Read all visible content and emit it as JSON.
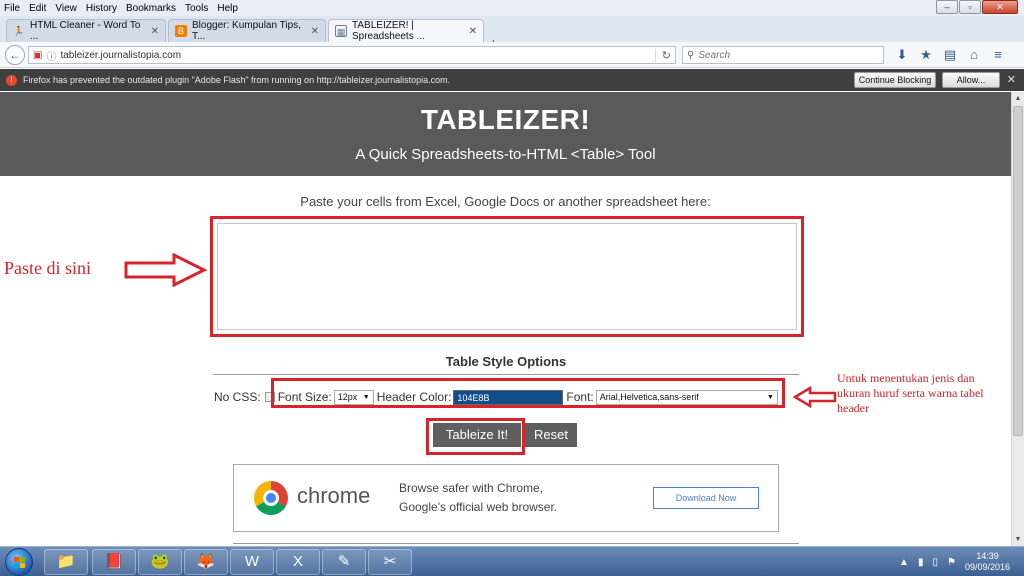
{
  "window": {
    "menu": [
      "File",
      "Edit",
      "View",
      "History",
      "Bookmarks",
      "Tools",
      "Help"
    ],
    "controls": {
      "minimize": "–",
      "restore": "▫",
      "close": "✕"
    }
  },
  "tabs": [
    {
      "label": "HTML Cleaner - Word To ...",
      "close": "✕"
    },
    {
      "label": "Blogger: Kumpulan Tips, T...",
      "close": "✕"
    },
    {
      "label": "TABLEIZER! | Spreadsheets ...",
      "close": "✕"
    }
  ],
  "new_tab": "+",
  "nav": {
    "url": "tableizer.journalistopia.com",
    "search_placeholder": "Search"
  },
  "notification": {
    "text": "Firefox has prevented the outdated plugin \"Adobe Flash\" from running on http://tableizer.journalistopia.com.",
    "continue_blocking": "Continue Blocking",
    "allow": "Allow...",
    "close": "✕"
  },
  "page": {
    "title": "TABLEIZER!",
    "subtitle": "A Quick Spreadsheets-to-HTML <Table> Tool",
    "prompt": "Paste your cells from Excel, Google Docs or another spreadsheet here:",
    "options_title": "Table Style Options",
    "no_css_label": "No CSS:",
    "font_size_label": "Font Size:",
    "font_size_value": "12px",
    "header_color_label": "Header Color:",
    "header_color_value": "104E8B",
    "font_label": "Font:",
    "font_value": "Arial,Helvetica,sans-serif",
    "tableize_button": "Tableize It!",
    "reset_button": "Reset"
  },
  "annotations": {
    "left": "Paste di sini",
    "right": "Untuk menentukan jenis dan ukuran huruf serta warna tabel header",
    "color": "#d8232a"
  },
  "ad": {
    "brand": "chrome",
    "line1": "Browse safer with Chrome,",
    "line2": "Google's official web browser.",
    "download": "Download Now"
  },
  "taskbar": {
    "time": "14:39",
    "date": "09/09/2016"
  },
  "colors": {
    "hero_bg": "#5a5a5a",
    "header_color": "#104e8b",
    "button_bg": "#5f5f5f"
  }
}
